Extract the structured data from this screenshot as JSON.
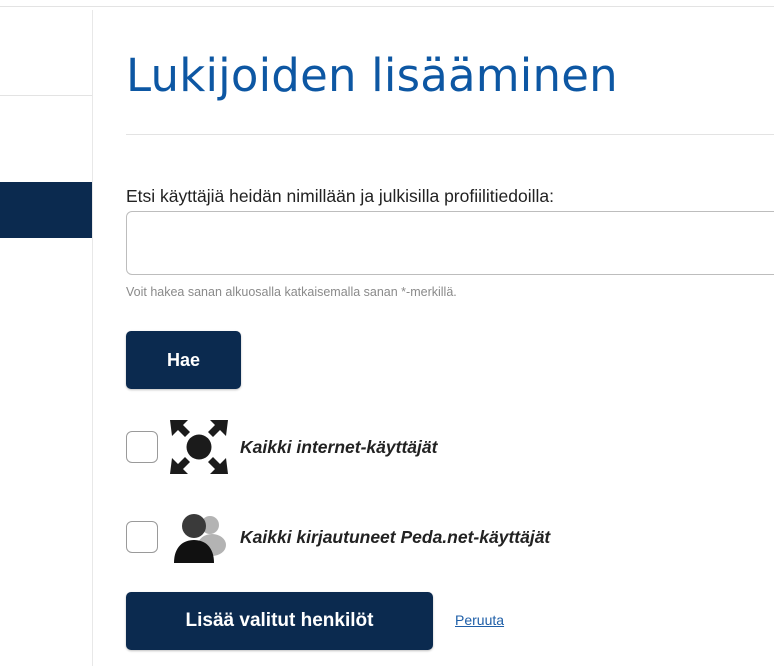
{
  "page": {
    "title": "Lukijoiden lisääminen"
  },
  "search": {
    "label": "Etsi käyttäjiä heidän nimillään ja julkisilla profiilitiedoilla:",
    "value": "",
    "placeholder": "",
    "hint": "Voit hakea sanan alkuosalla katkaisemalla sanan *-merkillä.",
    "button_label": "Hae"
  },
  "options": [
    {
      "label": "Kaikki internet-käyttäjät",
      "icon": "internet-users-icon",
      "checked": false
    },
    {
      "label": "Kaikki kirjautuneet Peda.net-käyttäjät",
      "icon": "logged-in-users-icon",
      "checked": false
    }
  ],
  "actions": {
    "add_label": "Lisää valitut henkilöt",
    "cancel_label": "Peruuta"
  },
  "colors": {
    "accent": "#0b2a4f",
    "title": "#0d57a3",
    "link": "#1f5fa8"
  }
}
